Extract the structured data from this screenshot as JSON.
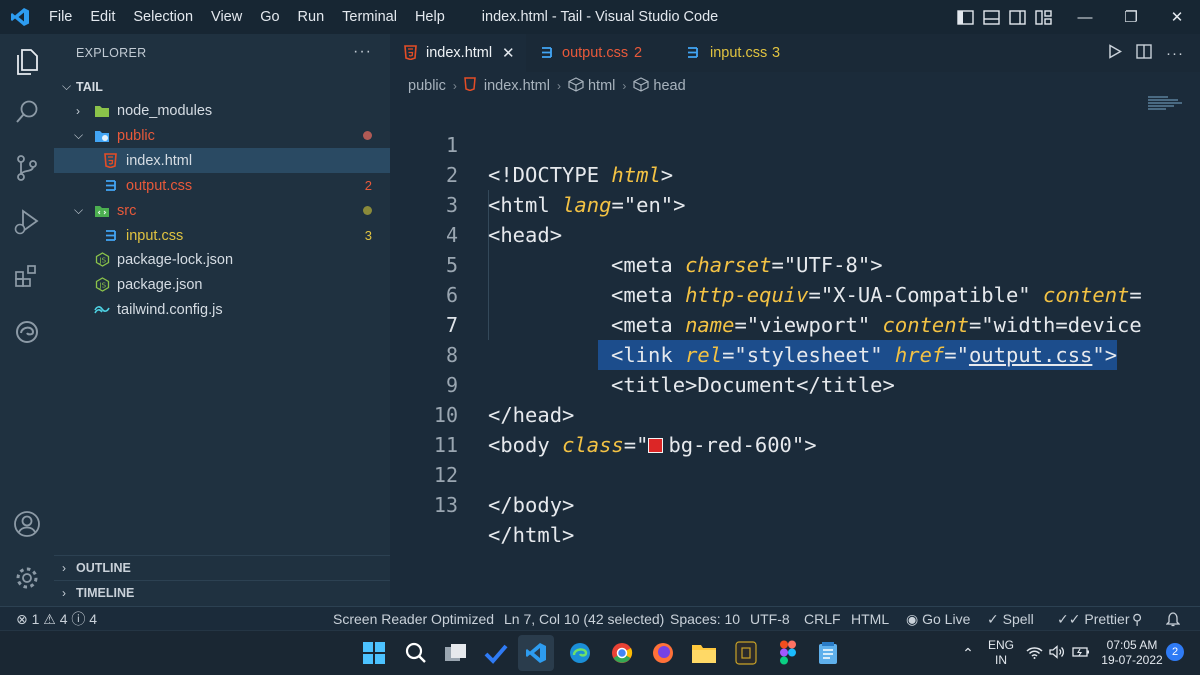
{
  "titlebar": {
    "menu": [
      "File",
      "Edit",
      "Selection",
      "View",
      "Go",
      "Run",
      "Terminal",
      "Help"
    ],
    "title": "index.html - Tail - Visual Studio Code"
  },
  "explorer": {
    "header": "EXPLORER",
    "more": "···",
    "root": "TAIL",
    "items": [
      {
        "label": "node_modules",
        "kind": "folder"
      },
      {
        "label": "public",
        "kind": "folder"
      },
      {
        "label": "index.html",
        "kind": "html"
      },
      {
        "label": "output.css",
        "kind": "css",
        "badge": "2"
      },
      {
        "label": "src",
        "kind": "folder"
      },
      {
        "label": "input.css",
        "kind": "css",
        "badge": "3"
      },
      {
        "label": "package-lock.json",
        "kind": "json"
      },
      {
        "label": "package.json",
        "kind": "json"
      },
      {
        "label": "tailwind.config.js",
        "kind": "tailwind"
      }
    ],
    "outline": "OUTLINE",
    "timeline": "TIMELINE"
  },
  "tabs": [
    {
      "label": "index.html",
      "badge": ""
    },
    {
      "label": "output.css",
      "badge": "2"
    },
    {
      "label": "input.css",
      "badge": "3"
    }
  ],
  "breadcrumb": [
    "public",
    "index.html",
    "html",
    "head"
  ],
  "code_lines": [
    {
      "n": "1"
    },
    {
      "n": "2"
    },
    {
      "n": "3"
    },
    {
      "n": "4"
    },
    {
      "n": "5"
    },
    {
      "n": "6"
    },
    {
      "n": "7"
    },
    {
      "n": "8"
    },
    {
      "n": "9"
    },
    {
      "n": "10"
    },
    {
      "n": "11"
    },
    {
      "n": "12"
    },
    {
      "n": "13"
    }
  ],
  "code": {
    "l1_a": "<!DOCTYPE ",
    "l1_b": "html",
    "l1_c": ">",
    "l2_a": "<html ",
    "l2_b": "lang",
    "l2_c": "=\"en\">",
    "l3": "<head>",
    "l4_a": "<meta ",
    "l4_b": "charset",
    "l4_c": "=\"UTF-8\">",
    "l5_a": "<meta ",
    "l5_b": "http-equiv",
    "l5_c": "=\"X-UA-Compatible\" ",
    "l5_d": "content",
    "l5_e": "=",
    "l6_a": "<meta ",
    "l6_b": "name",
    "l6_c": "=\"viewport\" ",
    "l6_d": "content",
    "l6_e": "=\"width=device",
    "l7_a": "<link ",
    "l7_b": "rel",
    "l7_c": "=\"stylesheet\" ",
    "l7_d": "href",
    "l7_e": "=\"",
    "l7_f": "output.css",
    "l7_g": "\">",
    "l8": "<title>Document</title>",
    "l9": "</head>",
    "l10_a": "<body ",
    "l10_b": "class",
    "l10_c": "=\"",
    "l10_d": "bg-red-600\">",
    "l12": "</body>",
    "l13": "</html>"
  },
  "statusbar": {
    "problems": "⊗ 1 ⚠ 4 ⓘ 4",
    "screen_reader": "Screen Reader Optimized",
    "position": "Ln 7, Col 10 (42 selected)",
    "spaces": "Spaces: 10",
    "encoding": "UTF-8",
    "eol": "CRLF",
    "language": "HTML",
    "golive": "Go Live",
    "spell": "Spell",
    "prettier": "Prettier"
  },
  "taskbar": {
    "lang_top": "ENG",
    "lang_bottom": "IN",
    "time": "07:05 AM",
    "date": "19-07-2022",
    "notifications": "2"
  },
  "colors": {
    "accent": "#0078d4",
    "selection": "#1c4d8c",
    "attribute": "#f3c244",
    "css_file": "#e8593a",
    "html_icon": "#e44d26"
  }
}
